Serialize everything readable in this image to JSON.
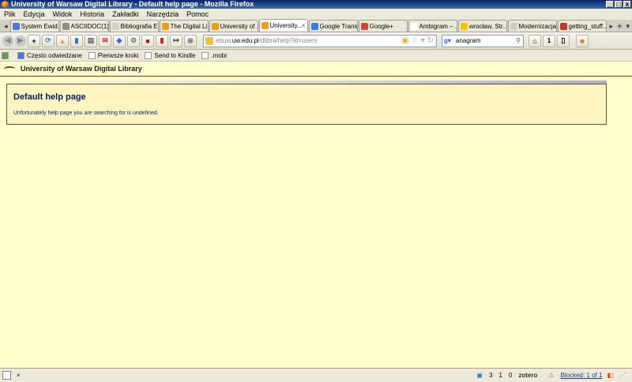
{
  "window": {
    "title": "University of Warsaw Digital Library - Default help page - Mozilla Firefox"
  },
  "menu": [
    "Plik",
    "Edycja",
    "Widok",
    "Historia",
    "Zakładki",
    "Narzędzia",
    "Pomoc"
  ],
  "tabs": [
    {
      "label": "System Ewid...",
      "icon_color": "#4a7bd0",
      "active": false
    },
    {
      "label": "ASCIIDOC(1)",
      "icon_color": "#8c8c8c",
      "active": false
    },
    {
      "label": "Bibliografia E...",
      "icon_color": "#d0d0d0",
      "active": false
    },
    {
      "label": "The Digital Li...",
      "icon_color": "#e8a020",
      "active": false
    },
    {
      "label": "University of ...",
      "icon_color": "#e8a020",
      "active": false
    },
    {
      "label": "University...",
      "icon_color": "#e8a020",
      "active": true
    },
    {
      "label": "Google Trans...",
      "icon_color": "#3b78e7",
      "active": false
    },
    {
      "label": "Google+",
      "icon_color": "#d34836",
      "active": false
    },
    {
      "label": "Ambigram – ...",
      "icon_color": "#ffffff",
      "active": false
    },
    {
      "label": "wrocław, Str...",
      "icon_color": "#f4c20d",
      "active": false
    },
    {
      "label": "Modernizacja...",
      "icon_color": "#cccccc",
      "active": false
    },
    {
      "label": "getting_stuff...",
      "icon_color": "#c0392b",
      "active": false
    }
  ],
  "nav": {
    "url_domain": "ebuw.",
    "url_host": "uw.edu.pl",
    "url_path": "/dlibra/help?id=users",
    "search_engine": "Google",
    "search_value": "anagram"
  },
  "bookmarks": [
    "Często odwiedzane",
    "Pierwsze kroki",
    "Send to Kindle",
    ".mobi"
  ],
  "page": {
    "library_name": "University of Warsaw Digital Library",
    "help_title": "Default help page",
    "help_message": "Unfortunately help page you are searching for is undefined."
  },
  "status": {
    "close_label": "×",
    "count_a": "3",
    "count_b": "1",
    "count_c": "0",
    "zotero_label": "zotero",
    "blocked_label": "Blocked: 1 of 1"
  },
  "colors": {
    "page_background": "#fffecc",
    "help_box_background": "#fff5c0",
    "header_rule": "#7a3b2a",
    "heading_text": "#0a1a5a"
  }
}
